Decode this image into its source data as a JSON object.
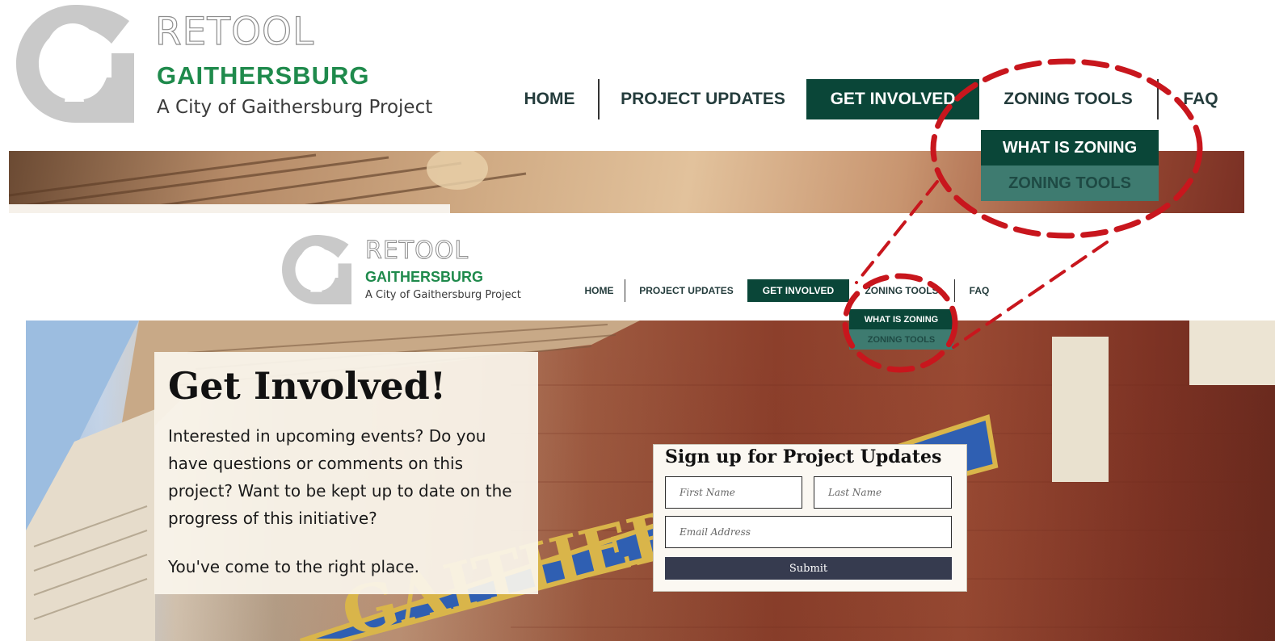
{
  "brand": {
    "retool": "RETOOL",
    "gaithersburg": "GAITHERSBURG",
    "tagline": "A City of Gaithersburg Project"
  },
  "nav": {
    "home": "HOME",
    "project_updates": "PROJECT UPDATES",
    "get_involved": "GET INVOLVED",
    "zoning_tools": "ZONING TOOLS",
    "faq": "FAQ"
  },
  "dropdown": {
    "what_is_zoning": "WHAT IS ZONING",
    "zoning_tools": "ZONING TOOLS"
  },
  "intro": {
    "title": "Get Involved!",
    "body": "Interested in upcoming events? Do you have questions or comments on this project? Want to be kept up to date on the progress of this initiative?",
    "closing": "You've come to the right place."
  },
  "signup": {
    "title": "Sign up for Project Updates",
    "first_name_placeholder": "First Name",
    "last_name_placeholder": "Last Name",
    "email_placeholder": "Email Address",
    "submit": "Submit"
  },
  "building_sign": "GAITHER",
  "colors": {
    "nav_active": "#0a4638",
    "dropdown_primary": "#0a4638",
    "dropdown_secondary": "#3e7b70",
    "brand_green": "#1f8a4c",
    "annotation_red": "#c8161d",
    "submit_button": "#363b4f"
  }
}
